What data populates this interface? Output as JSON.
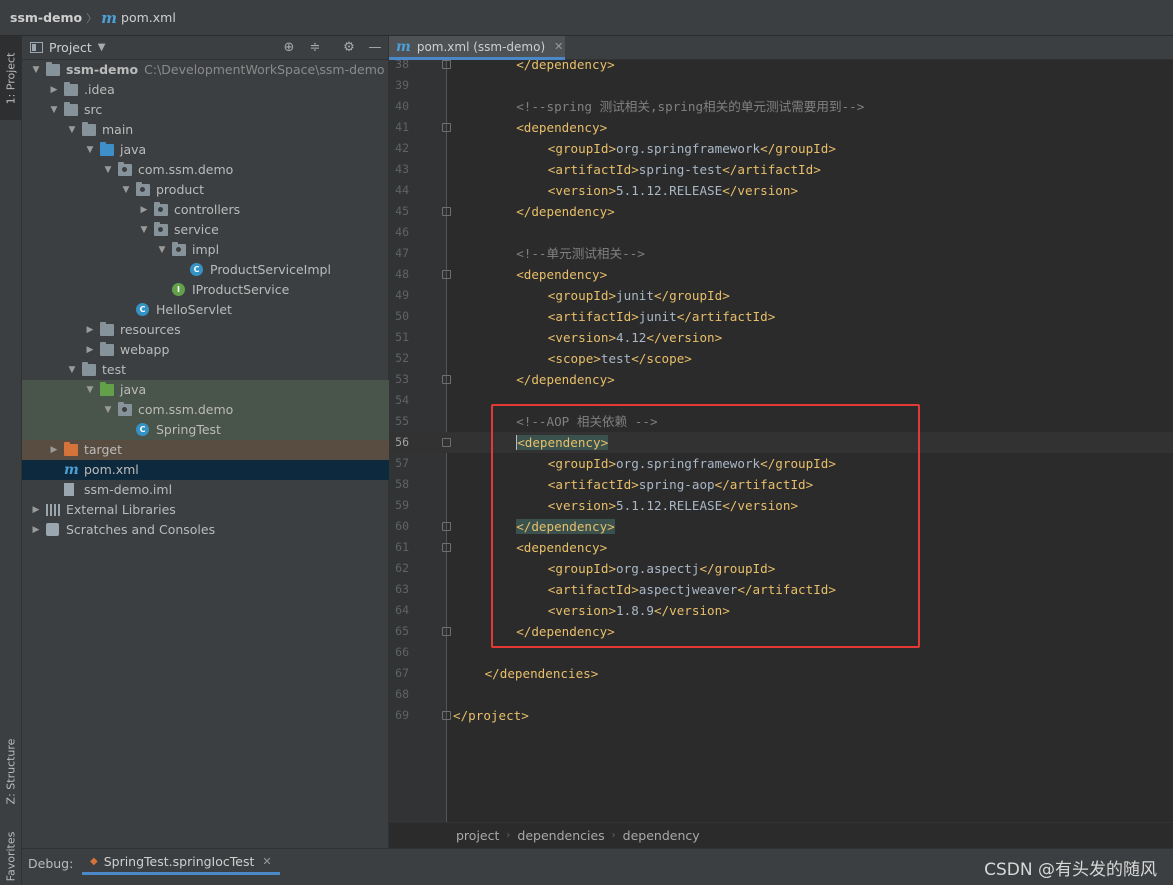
{
  "breadcrumb": {
    "project": "ssm-demo",
    "file": "pom.xml"
  },
  "side_tabs": {
    "project": "1: Project",
    "structure": "Z: Structure",
    "favorites": "Favorites"
  },
  "project_panel": {
    "title": "Project"
  },
  "tree": [
    {
      "label": "ssm-demo",
      "path": "C:\\DevelopmentWorkSpace\\ssm-demo",
      "indent": 0,
      "arrow": "down",
      "icon": "module-folder-icon",
      "bold": true
    },
    {
      "label": ".idea",
      "indent": 1,
      "arrow": "right",
      "icon": "folder-icon"
    },
    {
      "label": "src",
      "indent": 1,
      "arrow": "down",
      "icon": "folder-icon"
    },
    {
      "label": "main",
      "indent": 2,
      "arrow": "down",
      "icon": "folder-icon"
    },
    {
      "label": "java",
      "indent": 3,
      "arrow": "down",
      "icon": "source-folder-icon"
    },
    {
      "label": "com.ssm.demo",
      "indent": 4,
      "arrow": "down",
      "icon": "package-icon"
    },
    {
      "label": "product",
      "indent": 5,
      "arrow": "down",
      "icon": "package-icon"
    },
    {
      "label": "controllers",
      "indent": 6,
      "arrow": "right",
      "icon": "package-icon"
    },
    {
      "label": "service",
      "indent": 6,
      "arrow": "down",
      "icon": "package-icon"
    },
    {
      "label": "impl",
      "indent": 7,
      "arrow": "down",
      "icon": "package-icon"
    },
    {
      "label": "ProductServiceImpl",
      "indent": 8,
      "arrow": "none",
      "icon": "class-icon"
    },
    {
      "label": "IProductService",
      "indent": 7,
      "arrow": "none",
      "icon": "interface-icon"
    },
    {
      "label": "HelloServlet",
      "indent": 5,
      "arrow": "none",
      "icon": "class-icon"
    },
    {
      "label": "resources",
      "indent": 3,
      "arrow": "right",
      "icon": "resources-folder-icon"
    },
    {
      "label": "webapp",
      "indent": 3,
      "arrow": "right",
      "icon": "web-folder-icon"
    },
    {
      "label": "test",
      "indent": 2,
      "arrow": "down",
      "icon": "folder-icon"
    },
    {
      "label": "java",
      "indent": 3,
      "arrow": "down",
      "icon": "test-folder-icon",
      "bg": "test"
    },
    {
      "label": "com.ssm.demo",
      "indent": 4,
      "arrow": "down",
      "icon": "package-icon",
      "bg": "test"
    },
    {
      "label": "SpringTest",
      "indent": 5,
      "arrow": "none",
      "icon": "test-class-icon",
      "bg": "test"
    },
    {
      "label": "target",
      "indent": 1,
      "arrow": "right",
      "icon": "excluded-folder-icon",
      "bg": "target"
    },
    {
      "label": "pom.xml",
      "indent": 1,
      "arrow": "none",
      "icon": "maven-icon",
      "bg": "selected"
    },
    {
      "label": "ssm-demo.iml",
      "indent": 1,
      "arrow": "none",
      "icon": "iml-file-icon"
    },
    {
      "label": "External Libraries",
      "indent": 0,
      "arrow": "right",
      "icon": "libraries-icon"
    },
    {
      "label": "Scratches and Consoles",
      "indent": 0,
      "arrow": "right",
      "icon": "scratches-icon"
    }
  ],
  "editor_tab": {
    "label": "pom.xml (ssm-demo)"
  },
  "code_lines": [
    {
      "n": "38",
      "indent": 8,
      "fold": true,
      "parts": [
        {
          "t": "</dependency>",
          "c": "tag"
        }
      ]
    },
    {
      "n": "39",
      "indent": 0,
      "parts": []
    },
    {
      "n": "40",
      "indent": 8,
      "parts": [
        {
          "t": "<!--spring 测试相关,spring相关的单元测试需要用到-->",
          "c": "cmt"
        }
      ]
    },
    {
      "n": "41",
      "indent": 8,
      "fold": true,
      "parts": [
        {
          "t": "<dependency>",
          "c": "tag"
        }
      ]
    },
    {
      "n": "42",
      "indent": 12,
      "parts": [
        {
          "t": "<groupId>",
          "c": "tag"
        },
        {
          "t": "org.springframework",
          "c": "plain"
        },
        {
          "t": "</groupId>",
          "c": "tag"
        }
      ]
    },
    {
      "n": "43",
      "indent": 12,
      "parts": [
        {
          "t": "<artifactId>",
          "c": "tag"
        },
        {
          "t": "spring-test",
          "c": "plain"
        },
        {
          "t": "</artifactId>",
          "c": "tag"
        }
      ]
    },
    {
      "n": "44",
      "indent": 12,
      "parts": [
        {
          "t": "<version>",
          "c": "tag"
        },
        {
          "t": "5.1.12.RELEASE",
          "c": "plain"
        },
        {
          "t": "</version>",
          "c": "tag"
        }
      ]
    },
    {
      "n": "45",
      "indent": 8,
      "fold": true,
      "parts": [
        {
          "t": "</dependency>",
          "c": "tag"
        }
      ]
    },
    {
      "n": "46",
      "indent": 0,
      "parts": []
    },
    {
      "n": "47",
      "indent": 8,
      "parts": [
        {
          "t": "<!--单元测试相关-->",
          "c": "cmt"
        }
      ]
    },
    {
      "n": "48",
      "indent": 8,
      "fold": true,
      "parts": [
        {
          "t": "<dependency>",
          "c": "tag"
        }
      ]
    },
    {
      "n": "49",
      "indent": 12,
      "parts": [
        {
          "t": "<groupId>",
          "c": "tag"
        },
        {
          "t": "junit",
          "c": "plain"
        },
        {
          "t": "</groupId>",
          "c": "tag"
        }
      ]
    },
    {
      "n": "50",
      "indent": 12,
      "parts": [
        {
          "t": "<artifactId>",
          "c": "tag"
        },
        {
          "t": "junit",
          "c": "plain"
        },
        {
          "t": "</artifactId>",
          "c": "tag"
        }
      ]
    },
    {
      "n": "51",
      "indent": 12,
      "parts": [
        {
          "t": "<version>",
          "c": "tag"
        },
        {
          "t": "4.12",
          "c": "plain"
        },
        {
          "t": "</version>",
          "c": "tag"
        }
      ]
    },
    {
      "n": "52",
      "indent": 12,
      "parts": [
        {
          "t": "<scope>",
          "c": "tag"
        },
        {
          "t": "test",
          "c": "plain"
        },
        {
          "t": "</scope>",
          "c": "tag"
        }
      ]
    },
    {
      "n": "53",
      "indent": 8,
      "fold": true,
      "parts": [
        {
          "t": "</dependency>",
          "c": "tag"
        }
      ]
    },
    {
      "n": "54",
      "indent": 0,
      "parts": []
    },
    {
      "n": "55",
      "indent": 8,
      "parts": [
        {
          "t": "<!--AOP 相关依赖 -->",
          "c": "cmt"
        }
      ]
    },
    {
      "n": "56",
      "indent": 8,
      "fold": true,
      "current": true,
      "parts": [
        {
          "t": "<dependency>",
          "c": "tag hl"
        }
      ]
    },
    {
      "n": "57",
      "indent": 12,
      "parts": [
        {
          "t": "<groupId>",
          "c": "tag"
        },
        {
          "t": "org.springframework",
          "c": "plain"
        },
        {
          "t": "</groupId>",
          "c": "tag"
        }
      ]
    },
    {
      "n": "58",
      "indent": 12,
      "parts": [
        {
          "t": "<artifactId>",
          "c": "tag"
        },
        {
          "t": "spring-aop",
          "c": "plain"
        },
        {
          "t": "</artifactId>",
          "c": "tag"
        }
      ]
    },
    {
      "n": "59",
      "indent": 12,
      "parts": [
        {
          "t": "<version>",
          "c": "tag"
        },
        {
          "t": "5.1.12.RELEASE",
          "c": "plain"
        },
        {
          "t": "</version>",
          "c": "tag"
        }
      ]
    },
    {
      "n": "60",
      "indent": 8,
      "fold": true,
      "parts": [
        {
          "t": "</dependency>",
          "c": "tag hl"
        }
      ]
    },
    {
      "n": "61",
      "indent": 8,
      "fold": true,
      "parts": [
        {
          "t": "<dependency>",
          "c": "tag"
        }
      ]
    },
    {
      "n": "62",
      "indent": 12,
      "parts": [
        {
          "t": "<groupId>",
          "c": "tag"
        },
        {
          "t": "org.aspectj",
          "c": "plain"
        },
        {
          "t": "</groupId>",
          "c": "tag"
        }
      ]
    },
    {
      "n": "63",
      "indent": 12,
      "parts": [
        {
          "t": "<artifactId>",
          "c": "tag"
        },
        {
          "t": "aspectjweaver",
          "c": "plain"
        },
        {
          "t": "</artifactId>",
          "c": "tag"
        }
      ]
    },
    {
      "n": "64",
      "indent": 12,
      "parts": [
        {
          "t": "<version>",
          "c": "tag"
        },
        {
          "t": "1.8.9",
          "c": "plain"
        },
        {
          "t": "</version>",
          "c": "tag"
        }
      ]
    },
    {
      "n": "65",
      "indent": 8,
      "fold": true,
      "parts": [
        {
          "t": "</dependency>",
          "c": "tag"
        }
      ]
    },
    {
      "n": "66",
      "indent": 0,
      "parts": []
    },
    {
      "n": "67",
      "indent": 4,
      "parts": [
        {
          "t": "</dependencies>",
          "c": "tag"
        }
      ]
    },
    {
      "n": "68",
      "indent": 0,
      "parts": []
    },
    {
      "n": "69",
      "indent": 0,
      "fold": true,
      "parts": [
        {
          "t": "</project>",
          "c": "tag"
        }
      ]
    }
  ],
  "editor_breadcrumb": [
    "project",
    "dependencies",
    "dependency"
  ],
  "debug": {
    "label": "Debug:",
    "tab": "SpringTest.springIocTest"
  },
  "watermark": "CSDN @有头发的随风",
  "colors": {
    "tag": "#e8bf6a",
    "comment": "#808080",
    "text": "#a9b7c6",
    "highlight_box": "#e53935",
    "selection": "#0d293e"
  }
}
